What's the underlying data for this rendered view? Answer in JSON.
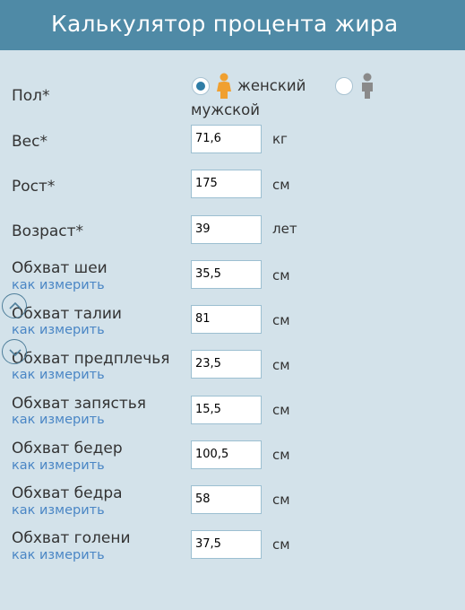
{
  "header": {
    "title": "Калькулятор процента жира"
  },
  "gender": {
    "label": "Пол*",
    "female_label": "женский",
    "male_label": "мужской",
    "selected": "female"
  },
  "measure_link": "как измерить",
  "fields": [
    {
      "label": "Вес*",
      "value": "71,6",
      "unit": "кг"
    },
    {
      "label": "Рост*",
      "value": "175",
      "unit": "см"
    },
    {
      "label": "Возраст*",
      "value": "39",
      "unit": "лет"
    },
    {
      "label": "Обхват шеи",
      "value": "35,5",
      "unit": "см"
    },
    {
      "label": "Обхват талии",
      "value": "81",
      "unit": "см"
    },
    {
      "label": "Обхват предплечья",
      "value": "23,5",
      "unit": "см"
    },
    {
      "label": "Обхват запястья",
      "value": "15,5",
      "unit": "см"
    },
    {
      "label": "Обхват бедер",
      "value": "100,5",
      "unit": "см"
    },
    {
      "label": "Обхват бедра",
      "value": "58",
      "unit": "см"
    },
    {
      "label": "Обхват голени",
      "value": "37,5",
      "unit": "см"
    }
  ],
  "colors": {
    "header_bg": "#4f8aa6",
    "page_bg": "#d3e2ea",
    "link": "#4a86c5",
    "female_icon": "#f0a030",
    "male_icon": "#8a8a8a"
  },
  "icons": [
    "female-person-icon",
    "male-person-icon",
    "scroll-up-icon",
    "scroll-down-icon"
  ]
}
